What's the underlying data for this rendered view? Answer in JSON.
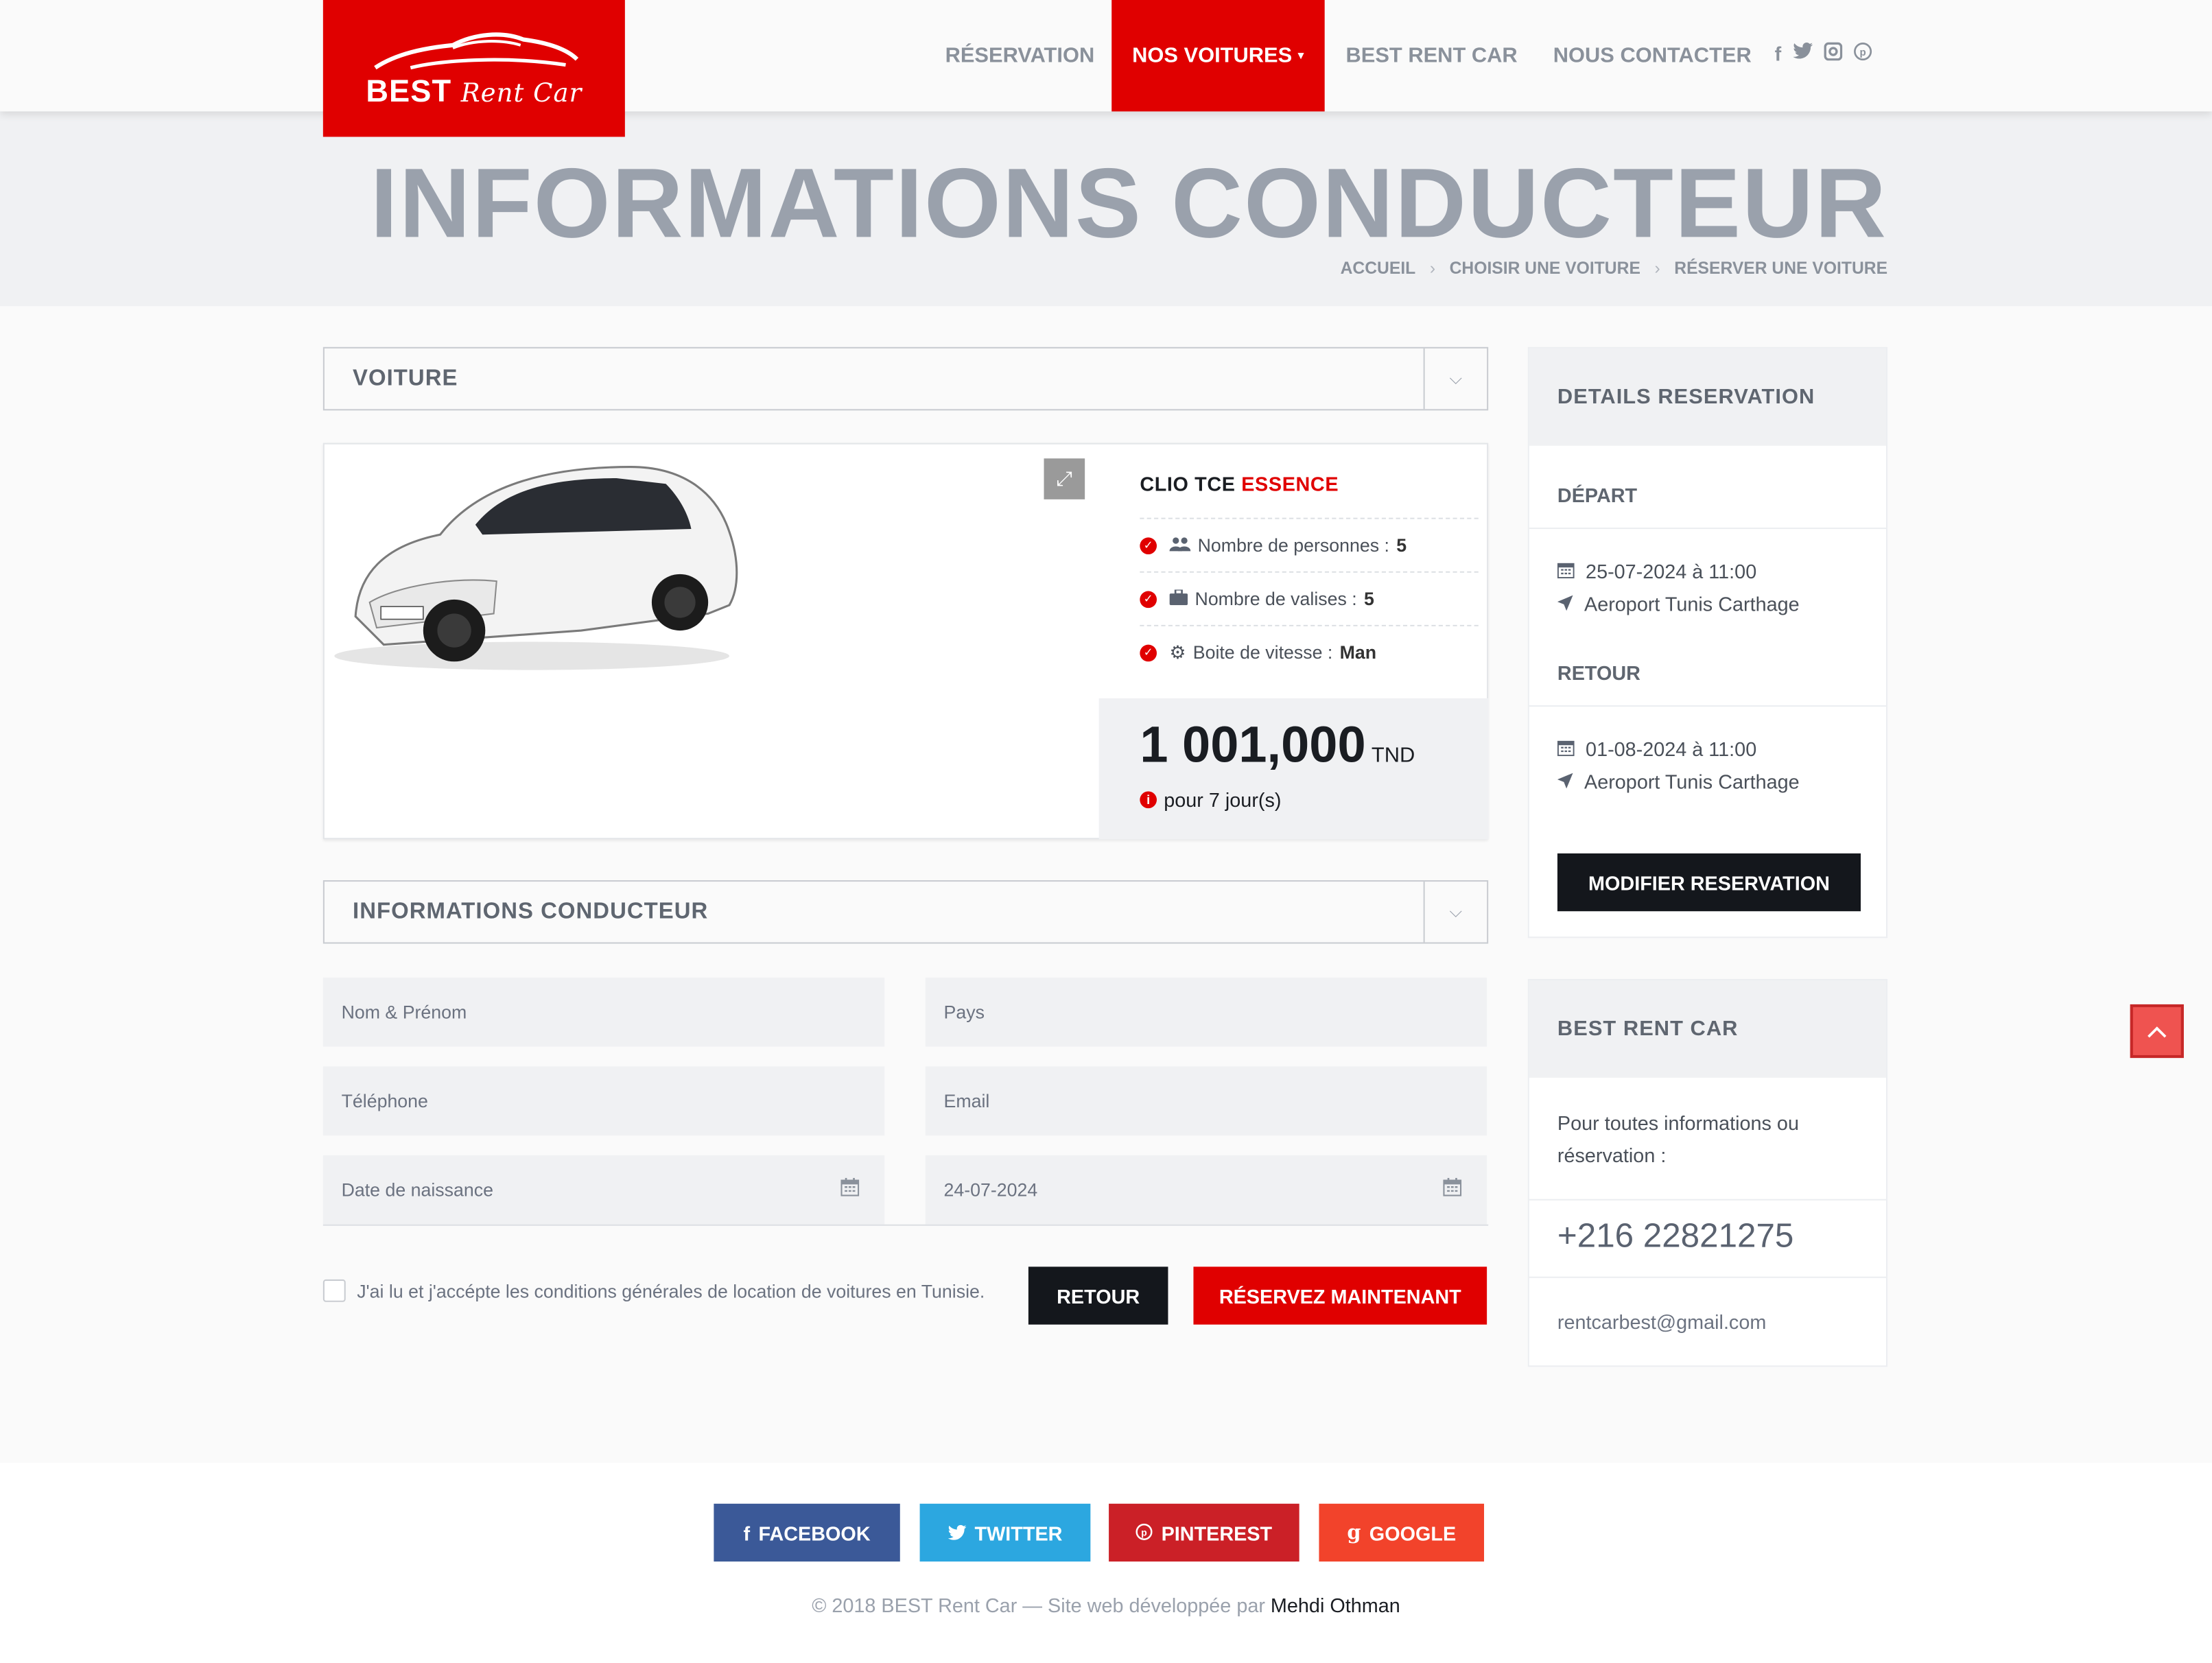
{
  "header": {
    "logo": {
      "brand": "BEST",
      "sub": "Rent Car"
    },
    "nav": [
      {
        "label": "RÉSERVATION"
      },
      {
        "label": "NOS VOITURES"
      },
      {
        "label": "BEST RENT CAR"
      },
      {
        "label": "NOUS CONTACTER"
      }
    ],
    "social_icons": [
      "facebook-icon",
      "twitter-icon",
      "instagram-icon",
      "pinterest-icon"
    ]
  },
  "page": {
    "title": "INFORMATIONS CONDUCTEUR",
    "breadcrumb": [
      "ACCUEIL",
      "CHOISIR UNE VOITURE",
      "RÉSERVER UNE VOITURE"
    ]
  },
  "car_section": {
    "header": "VOITURE",
    "car": {
      "model": "CLIO TCE",
      "fuel": "ESSENCE",
      "specs": [
        {
          "label": "Nombre de personnes :",
          "value": "5",
          "icon": "users-icon"
        },
        {
          "label": "Nombre de valises :",
          "value": "5",
          "icon": "suitcase-icon"
        },
        {
          "label": "Boite de vitesse :",
          "value": "Man",
          "icon": "gear-icon"
        }
      ],
      "price": "1 001,000",
      "currency": "TND",
      "duration": "pour 7 jour(s)"
    }
  },
  "driver_section": {
    "header": "INFORMATIONS CONDUCTEUR",
    "fields": {
      "name_placeholder": "Nom & Prénom",
      "country_placeholder": "Pays",
      "phone_placeholder": "Téléphone",
      "email_placeholder": "Email",
      "birth_placeholder": "Date de naissance",
      "license_date_value": "24-07-2024"
    },
    "agree_label": "J'ai lu et j'accépte les conditions générales de location de voitures en Tunisie.",
    "back_button": "RETOUR",
    "submit_button": "RÉSERVEZ MAINTENANT"
  },
  "reservation_details": {
    "title": "DETAILS RESERVATION",
    "departure_label": "DÉPART",
    "departure_date": "25-07-2024 à 11:00",
    "departure_place": "Aeroport Tunis Carthage",
    "return_label": "RETOUR",
    "return_date": "01-08-2024 à 11:00",
    "return_place": "Aeroport Tunis Carthage",
    "modify_button": "MODIFIER RESERVATION"
  },
  "contact_box": {
    "title": "BEST RENT CAR",
    "text": "Pour toutes informations ou réservation :",
    "phone": "+216 22821275",
    "email": "rentcarbest@gmail.com"
  },
  "footer": {
    "social_buttons": [
      {
        "label": "FACEBOOK",
        "color": "#3b5998"
      },
      {
        "label": "TWITTER",
        "color": "#2ca7e0"
      },
      {
        "label": "PINTEREST",
        "color": "#cb2027"
      },
      {
        "label": "GOOGLE",
        "color": "#f2432b"
      }
    ],
    "copyright": "© 2018 BEST Rent Car — Site web développée par",
    "author": "Mehdi Othman"
  },
  "colors": {
    "accent": "#e00000",
    "dark": "#14171c",
    "muted": "#9aa1ac"
  }
}
